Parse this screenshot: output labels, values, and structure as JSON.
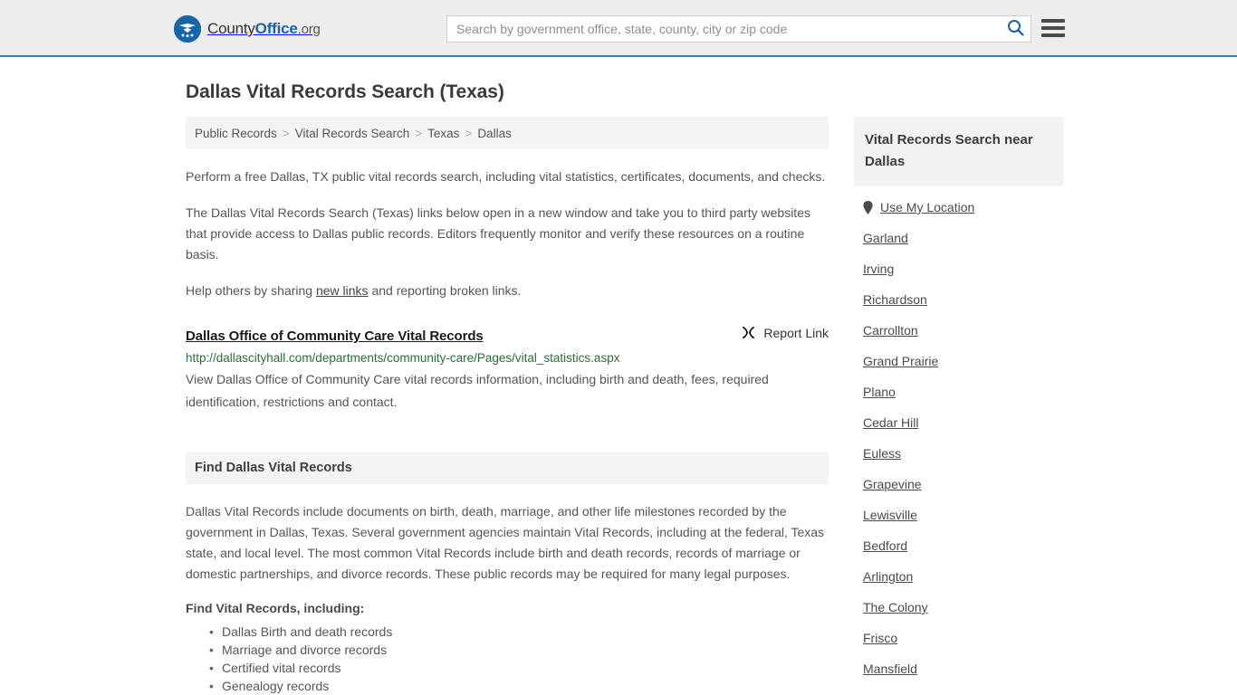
{
  "header": {
    "logo": {
      "icon": "countyoffice-eagle-seal-icon",
      "part1": "County",
      "part2": "Office",
      "part3": ".org"
    },
    "search": {
      "placeholder": "Search by government office, state, county, city or zip code",
      "value": "",
      "search_icon": "search-icon"
    },
    "menu_icon": "hamburger-menu-icon",
    "accent_color": "#1565a8",
    "border_color": "#3f7fb5",
    "background": "#ededed"
  },
  "page": {
    "title": "Dallas Vital Records Search (Texas)",
    "breadcrumb": [
      {
        "label": "Public Records"
      },
      {
        "label": "Vital Records Search"
      },
      {
        "label": "Texas"
      },
      {
        "label": "Dallas"
      }
    ],
    "breadcrumb_separator": ">",
    "intro_paragraph": "Perform a free Dallas, TX public vital records search, including vital statistics, certificates, documents, and checks.",
    "description_paragraph": "The Dallas Vital Records Search (Texas) links below open in a new window and take you to third party websites that provide access to Dallas public records. Editors frequently monitor and verify these resources on a routine basis.",
    "help_prefix": "Help others by sharing ",
    "help_link": "new links",
    "help_suffix": " and reporting broken links."
  },
  "result": {
    "title": "Dallas Office of Community Care Vital Records",
    "report_label": "Report Link",
    "report_icon": "broken-link-icon",
    "url": "http://dallascityhall.com/departments/community-care/Pages/vital_statistics.aspx",
    "url_color": "#2d6a3e",
    "description": "View Dallas Office of Community Care vital records information, including birth and death, fees, required identification, restrictions and contact."
  },
  "section": {
    "heading": "Find Dallas Vital Records",
    "body": "Dallas Vital Records include documents on birth, death, marriage, and other life milestones recorded by the government in Dallas, Texas. Several government agencies maintain Vital Records, including at the federal, Texas state, and local level. The most common Vital Records include birth and death records, records of marriage or domestic partnerships, and divorce records. These public records may be required for many legal purposes.",
    "sub_heading": "Find Vital Records, including:",
    "bullets": [
      "Dallas Birth and death records",
      "Marriage and divorce records",
      "Certified vital records",
      "Genealogy records"
    ]
  },
  "sidebar": {
    "heading": "Vital Records Search near Dallas",
    "use_my_location": {
      "label": "Use My Location",
      "icon": "map-pin-icon"
    },
    "cities": [
      "Garland",
      "Irving",
      "Richardson",
      "Carrollton",
      "Grand Prairie",
      "Plano",
      "Cedar Hill",
      "Euless",
      "Grapevine",
      "Lewisville",
      "Bedford",
      "Arlington",
      "The Colony",
      "Frisco",
      "Mansfield"
    ]
  }
}
